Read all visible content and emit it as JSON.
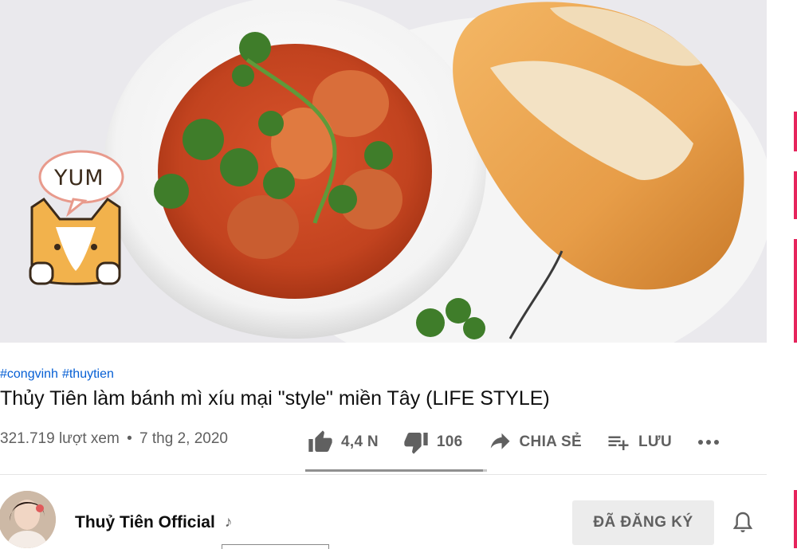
{
  "video": {
    "sticker_text": "YUM"
  },
  "hashtags": [
    "#congvinh",
    "#thuytien"
  ],
  "title": "Thủy Tiên làm bánh mì xíu mại \"style\" miền Tây (LIFE STYLE)",
  "meta": {
    "views": "321.719 lượt xem",
    "separator": "•",
    "date": "7 thg 2, 2020"
  },
  "actions": {
    "like_count": "4,4 N",
    "dislike_count": "106",
    "share_label": "CHIA SẺ",
    "save_label": "LƯU"
  },
  "like_ratio": 0.976,
  "channel": {
    "name": "Thuỷ Tiên Official",
    "badge": "♪"
  },
  "subscribe_label": "ĐÃ ĐĂNG KÝ",
  "colors": {
    "link": "#065fd4",
    "meta_text": "#606060",
    "subscribed_bg": "#ececec"
  }
}
